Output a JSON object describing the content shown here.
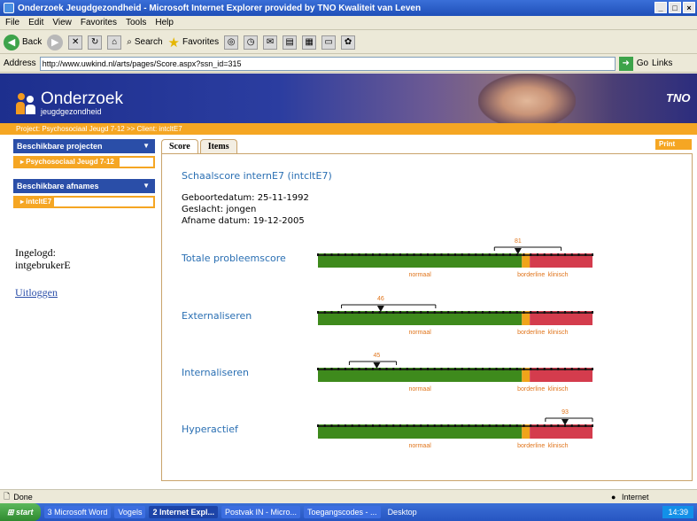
{
  "window": {
    "title": "Onderzoek Jeugdgezondheid - Microsoft Internet Explorer provided by TNO Kwaliteit van Leven"
  },
  "menu": [
    "File",
    "Edit",
    "View",
    "Favorites",
    "Tools",
    "Help"
  ],
  "toolbar": {
    "back_label": "Back",
    "search_label": "Search",
    "favorites_label": "Favorites"
  },
  "address": {
    "label": "Address",
    "url": "http://www.uwkind.nl/arts/pages/Score.aspx?ssn_id=315",
    "go_label": "Go",
    "links_label": "Links"
  },
  "site": {
    "logo_title": "Onderzoek",
    "logo_subtitle": "jeugdgezondheid",
    "partner_logo": "TNO",
    "breadcrumb": "Project: Psychosociaal Jeugd 7-12 >> Client: intcltE7"
  },
  "sidebar": {
    "projects_header": "Beschikbare projecten",
    "project_item": "Psychosociaal Jeugd 7-12",
    "afnames_header": "Beschikbare afnames",
    "afname_item": "intcltE7",
    "logged_in_label": "Ingelogd:",
    "username": "intgebrukerE",
    "logout_label": "Uitloggen"
  },
  "tabs": [
    {
      "label": "Score",
      "active": true
    },
    {
      "label": "Items",
      "active": false
    }
  ],
  "print_label": "Print",
  "score": {
    "title": "Schaalscore internE7 (intcltE7)",
    "birthdate": "Geboortedatum: 25-11-1992",
    "gender": "Geslacht: jongen",
    "date": "Afname datum: 19-12-2005"
  },
  "zone_labels": [
    "normaal",
    "borderline",
    "klinisch"
  ],
  "colors": {
    "normaal": "#3e8a1c",
    "borderline": "#f0a41a",
    "klinisch": "#d43c4d",
    "marker_text": "#e0751c",
    "label_blue": "#2a6fb3"
  },
  "scales": [
    {
      "name": "Totale probleemscore",
      "score": 81,
      "ci": [
        75,
        92
      ],
      "borderline_start": 82,
      "borderline_end": 84
    },
    {
      "name": "Externaliseren",
      "score": 46,
      "ci": [
        36,
        60
      ],
      "borderline_start": 82,
      "borderline_end": 84
    },
    {
      "name": "Internaliseren",
      "score": 45,
      "ci": [
        38,
        50
      ],
      "borderline_start": 82,
      "borderline_end": 84
    },
    {
      "name": "Hyperactief",
      "score": 93,
      "ci": [
        88,
        100
      ],
      "borderline_start": 82,
      "borderline_end": 84
    }
  ],
  "statusbar": {
    "status": "Done",
    "zone": "Internet"
  },
  "taskbar": {
    "start_label": "start",
    "items": [
      "3 Microsoft Word",
      "Vogels",
      "2 Internet Expl...",
      "Postvak IN - Micro...",
      "Toegangscodes - ...",
      "Desktop"
    ],
    "clock": "14:39"
  }
}
